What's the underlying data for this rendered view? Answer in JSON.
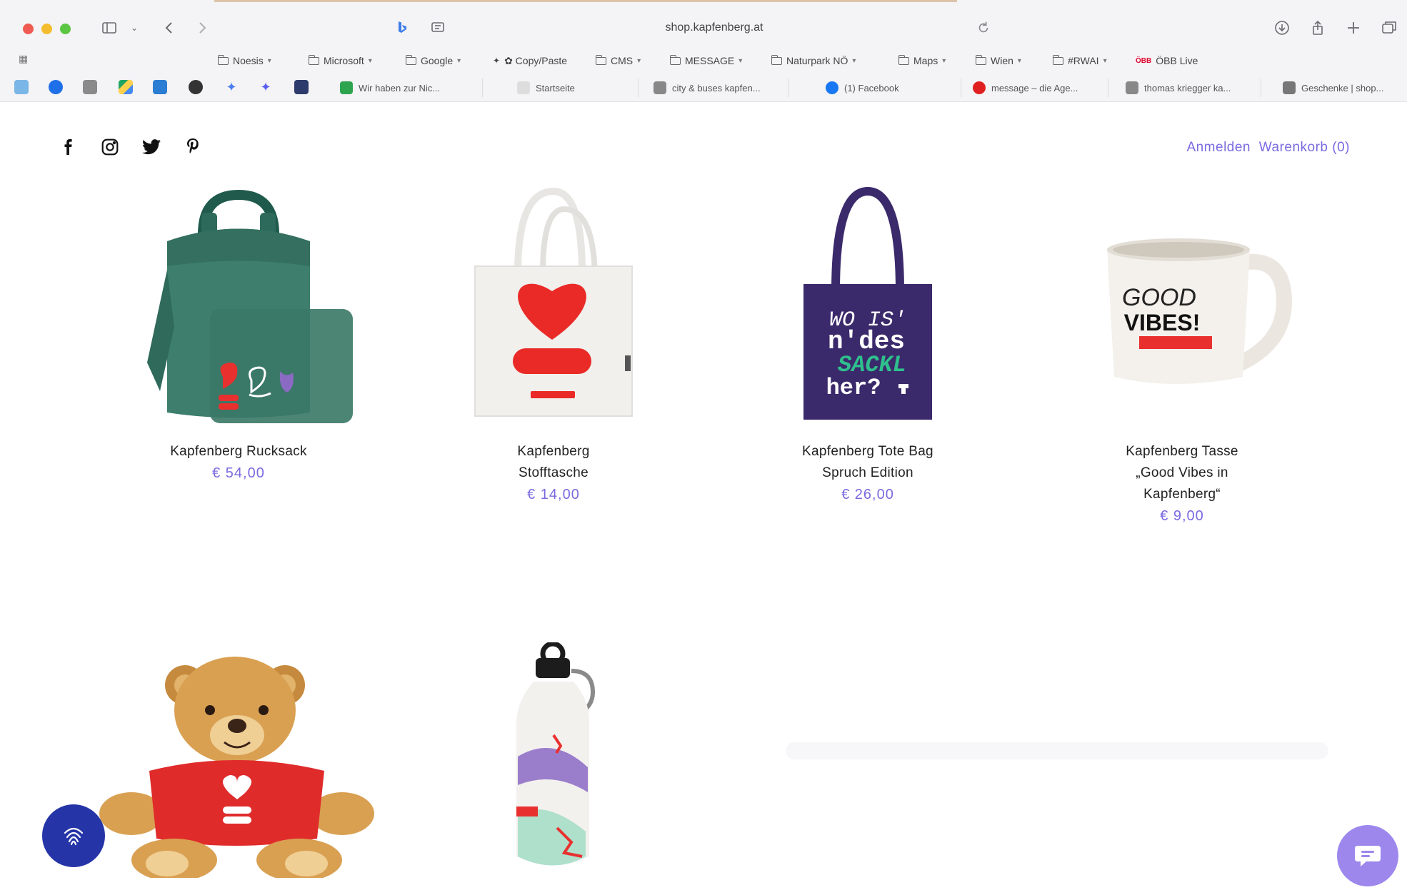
{
  "browser": {
    "url": "shop.kapfenberg.at",
    "bookmarks": [
      {
        "label": "Noesis",
        "type": "folder"
      },
      {
        "label": "Microsoft",
        "type": "folder"
      },
      {
        "label": "Google",
        "type": "folder"
      },
      {
        "label": "✿ Copy/Paste",
        "type": "link"
      },
      {
        "label": "CMS",
        "type": "folder"
      },
      {
        "label": "MESSAGE",
        "type": "folder"
      },
      {
        "label": "Naturpark NÖ",
        "type": "folder"
      },
      {
        "label": "Maps",
        "type": "folder"
      },
      {
        "label": "Wien",
        "type": "folder"
      },
      {
        "label": "#RWAI",
        "type": "folder"
      },
      {
        "label": "ÖBB Live",
        "type": "link"
      }
    ],
    "tabs": [
      {
        "label": "Wir haben zur Nic...",
        "color": "#2ea44f"
      },
      {
        "label": "Startseite",
        "color": "#999999"
      },
      {
        "label": "city & buses kapfen...",
        "color": "#888888"
      },
      {
        "label": "(1) Facebook",
        "color": "#1877f2"
      },
      {
        "label": "message – die Age...",
        "color": "#e02020"
      },
      {
        "label": "thomas kriegger ka...",
        "color": "#888888"
      },
      {
        "label": "Geschenke | shop...",
        "color": "#777777"
      }
    ]
  },
  "header": {
    "social_icons": [
      "facebook-icon",
      "instagram-icon",
      "twitter-icon",
      "pinterest-icon"
    ],
    "login_label": "Anmelden",
    "cart_label": "Warenkorb (0)"
  },
  "products": [
    {
      "name_lines": [
        "Kapfenberg Rucksack"
      ],
      "price": "€ 54,00"
    },
    {
      "name_lines": [
        "Kapfenberg",
        "Stofftasche"
      ],
      "price": "€ 14,00"
    },
    {
      "name_lines": [
        "Kapfenberg Tote Bag",
        "Spruch Edition"
      ],
      "price": "€ 26,00"
    },
    {
      "name_lines": [
        "Kapfenberg Tasse",
        "„Good Vibes in",
        "Kapfenberg“"
      ],
      "price": "€ 9,00"
    }
  ],
  "artwork": {
    "tote_text": [
      "WO IS'",
      "n'des",
      "SACKL",
      "her?"
    ],
    "mug_text": [
      "GOOD",
      "VIBES!"
    ]
  },
  "colors": {
    "accent": "#7a6ae0",
    "fab_left": "#2535a8",
    "fab_right": "#9d87ec"
  }
}
